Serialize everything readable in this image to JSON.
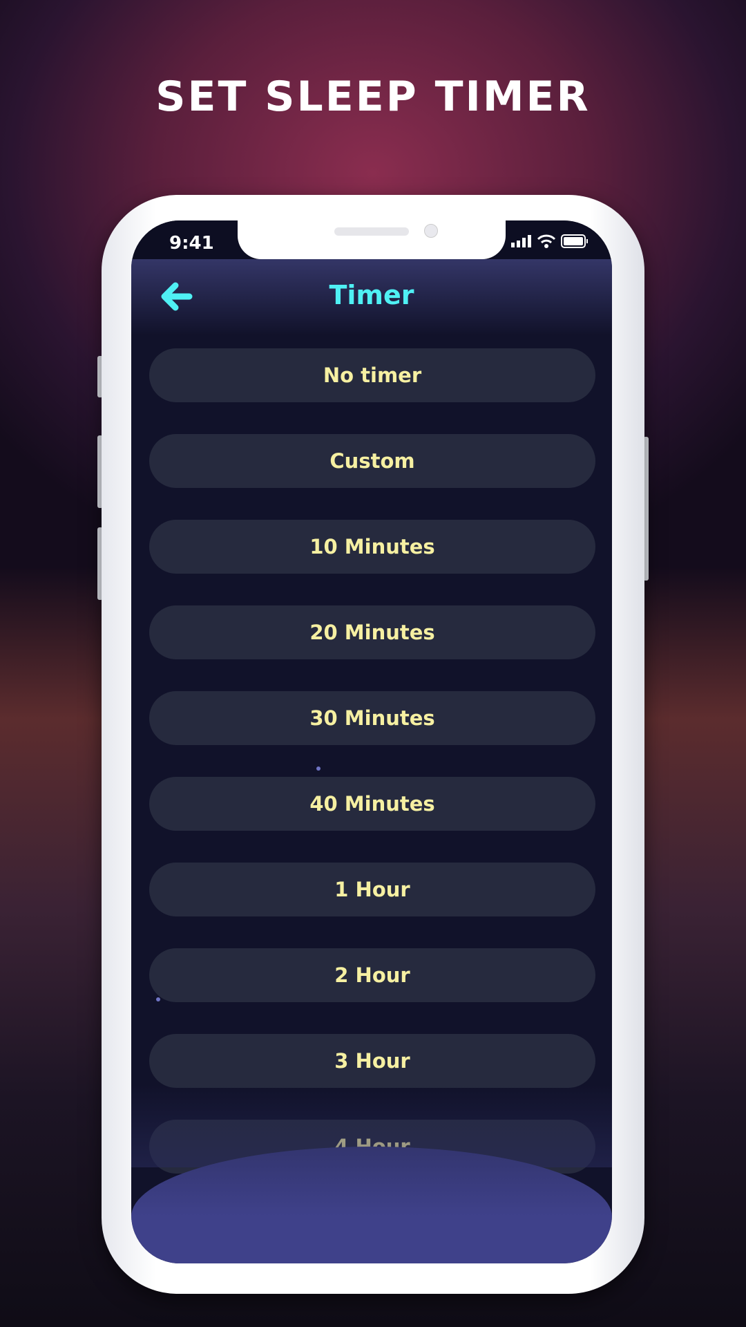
{
  "headline": "SET SLEEP TIMER",
  "status": {
    "time": "9:41",
    "icons": [
      "signal-icon",
      "wifi-icon",
      "battery-icon"
    ]
  },
  "header": {
    "title": "Timer",
    "back_icon": "arrow-left-icon"
  },
  "options": [
    "No timer",
    "Custom",
    "10 Minutes",
    "20 Minutes",
    "30 Minutes",
    "40 Minutes",
    "1 Hour",
    "2 Hour",
    "3 Hour",
    "4 Hour"
  ],
  "colors": {
    "title": "#4ff0f4",
    "option_text": "#f6f0a2",
    "option_bg": "#262a3e",
    "screen_bg": "#11122a"
  }
}
